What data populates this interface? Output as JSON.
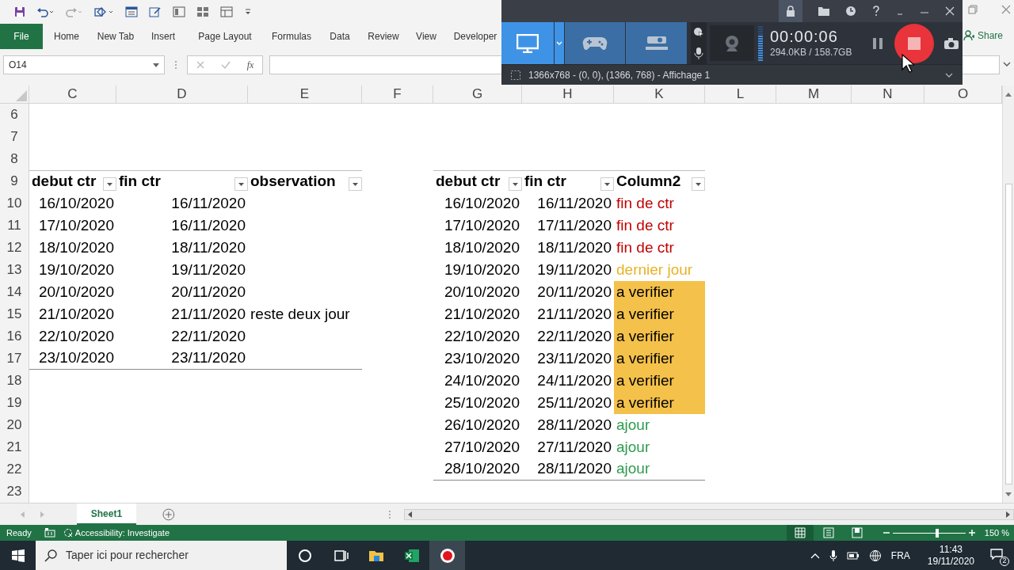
{
  "ribbon": {
    "file_tab": "File",
    "tabs": [
      "Home",
      "New Tab",
      "Insert",
      "Page Layout",
      "Formulas",
      "Data",
      "Review",
      "View",
      "Developer"
    ],
    "share_button": "Share"
  },
  "formula_bar": {
    "name_box": "O14",
    "function_label": "fx"
  },
  "sheet": {
    "column_headers": [
      "C",
      "D",
      "E",
      "F",
      "G",
      "H",
      "K",
      "L",
      "M",
      "N",
      "O"
    ],
    "row_numbers": [
      "6",
      "7",
      "8",
      "9",
      "10",
      "11",
      "12",
      "13",
      "14",
      "15",
      "16",
      "17",
      "18",
      "19",
      "20",
      "21",
      "22",
      "23"
    ],
    "table_1": {
      "headers": [
        "debut ctr",
        "fin ctr",
        "observation"
      ],
      "rows": [
        {
          "debut": "16/10/2020",
          "fin": "16/11/2020"
        },
        {
          "debut": "17/10/2020",
          "fin": "16/11/2020"
        },
        {
          "debut": "18/10/2020",
          "fin": "18/11/2020"
        },
        {
          "debut": "19/10/2020",
          "fin": "19/11/2020"
        },
        {
          "debut": "20/10/2020",
          "fin": "20/11/2020"
        },
        {
          "debut": "21/10/2020",
          "fin": "21/11/2020",
          "observation": "reste deux jour"
        },
        {
          "debut": "22/10/2020",
          "fin": "22/11/2020"
        },
        {
          "debut": "23/10/2020",
          "fin": "23/11/2020"
        }
      ]
    },
    "table_2": {
      "headers": [
        "debut ctr",
        "fin ctr",
        "Column2"
      ],
      "rows": [
        {
          "debut": "16/10/2020",
          "fin": "16/11/2020",
          "status": "fin de ctr",
          "kind": "expired"
        },
        {
          "debut": "17/10/2020",
          "fin": "17/11/2020",
          "status": "fin de ctr",
          "kind": "expired"
        },
        {
          "debut": "18/10/2020",
          "fin": "18/11/2020",
          "status": "fin de ctr",
          "kind": "expired"
        },
        {
          "debut": "19/10/2020",
          "fin": "19/11/2020",
          "status": "dernier jour",
          "kind": "last_day"
        },
        {
          "debut": "20/10/2020",
          "fin": "20/11/2020",
          "status": "a verifier",
          "kind": "verify"
        },
        {
          "debut": "21/10/2020",
          "fin": "21/11/2020",
          "status": "a verifier",
          "kind": "verify"
        },
        {
          "debut": "22/10/2020",
          "fin": "22/11/2020",
          "status": "a verifier",
          "kind": "verify"
        },
        {
          "debut": "23/10/2020",
          "fin": "23/11/2020",
          "status": "a verifier",
          "kind": "verify"
        },
        {
          "debut": "24/10/2020",
          "fin": "24/11/2020",
          "status": "a verifier",
          "kind": "verify"
        },
        {
          "debut": "25/10/2020",
          "fin": "25/11/2020",
          "status": "a verifier",
          "kind": "verify"
        },
        {
          "debut": "26/10/2020",
          "fin": "28/11/2020",
          "status": "ajour",
          "kind": "ok"
        },
        {
          "debut": "27/10/2020",
          "fin": "27/11/2020",
          "status": "ajour",
          "kind": "ok"
        },
        {
          "debut": "28/10/2020",
          "fin": "28/11/2020",
          "status": "ajour",
          "kind": "ok"
        }
      ]
    }
  },
  "sheet_tabs": [
    {
      "label": "Sheet1",
      "selected": true
    }
  ],
  "status_bar": {
    "ready": "Ready",
    "accessibility": "Accessibility: Investigate",
    "views": [
      {
        "kind": "normal",
        "selected": true
      },
      {
        "kind": "page_layout",
        "selected": false
      },
      {
        "kind": "page_break",
        "selected": false
      }
    ],
    "zoom": {
      "level": 0.59,
      "percent": "150 %"
    }
  },
  "recorder": {
    "modes": [
      {
        "kind": "screen",
        "selected": true
      },
      {
        "kind": "game",
        "selected": false
      },
      {
        "kind": "hdmi",
        "selected": false
      }
    ],
    "timer": "00:00:06",
    "file_size": "294.0KB / 158.7GB",
    "capture_area": "1366x768 - (0, 0), (1366, 768) - Affichage 1"
  },
  "taskbar": {
    "search_placeholder": "Taper ici pour rechercher",
    "apps": [
      {
        "kind": "cortana",
        "selected": false
      },
      {
        "kind": "task_view",
        "selected": false
      },
      {
        "kind": "explorer",
        "selected": false
      },
      {
        "kind": "excel",
        "selected": false
      },
      {
        "kind": "recorder",
        "selected": true
      }
    ],
    "language": "FRA",
    "time": "11:43",
    "date": "19/11/2020",
    "notification_count": "2"
  }
}
